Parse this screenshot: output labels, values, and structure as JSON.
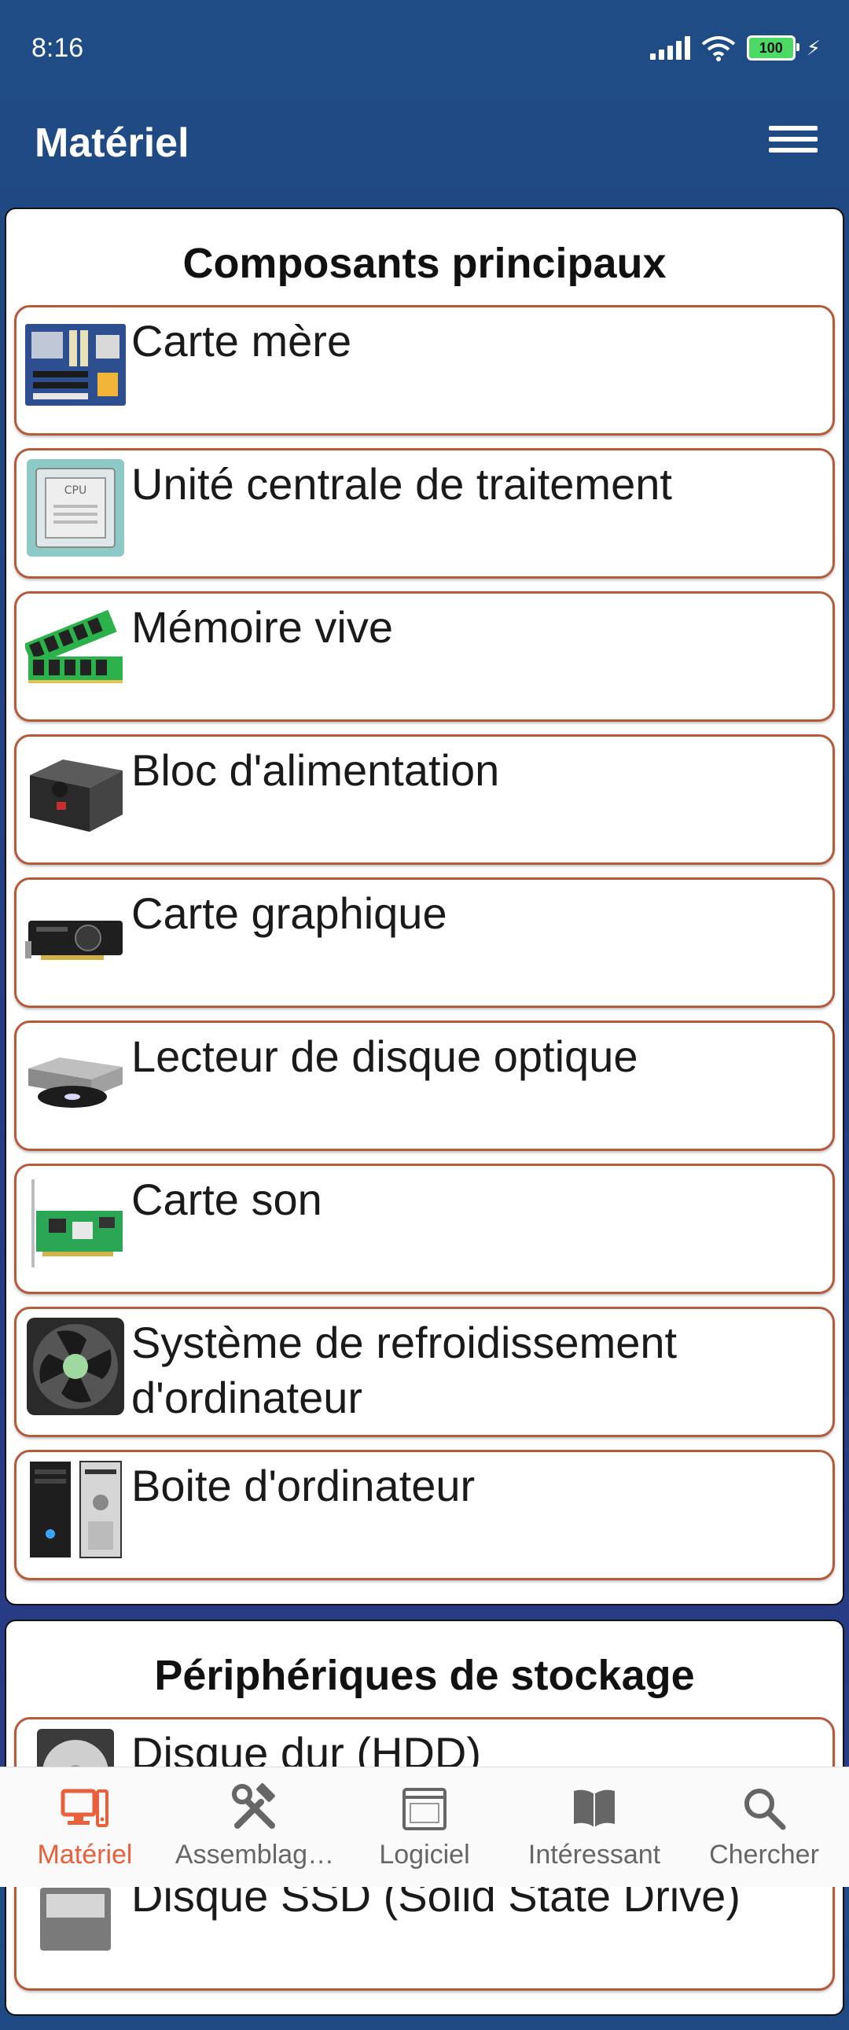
{
  "status_bar": {
    "time": "8:16",
    "battery": "100"
  },
  "app_bar": {
    "title": "Matériel"
  },
  "sections": [
    {
      "title": "Composants principaux",
      "items": [
        {
          "label": "Carte mère",
          "icon": "motherboard-icon"
        },
        {
          "label": "Unité centrale de traitement",
          "icon": "cpu-icon"
        },
        {
          "label": "Mémoire vive",
          "icon": "ram-icon"
        },
        {
          "label": "Bloc d'alimentation",
          "icon": "power-supply-icon"
        },
        {
          "label": "Carte graphique",
          "icon": "graphics-card-icon"
        },
        {
          "label": "Lecteur de disque optique",
          "icon": "optical-drive-icon"
        },
        {
          "label": "Carte son",
          "icon": "sound-card-icon"
        },
        {
          "label": "Système de refroidissement d'ordinateur",
          "icon": "cooling-fan-icon"
        },
        {
          "label": "Boite d'ordinateur",
          "icon": "computer-case-icon"
        }
      ]
    },
    {
      "title": "Périphériques de stockage",
      "items": [
        {
          "label": "Disque dur (HDD)",
          "icon": "hard-disk-icon"
        },
        {
          "label": "Disque SSD (Solid State Drive)",
          "icon": "ssd-icon"
        }
      ]
    }
  ],
  "bottom_nav": [
    {
      "label": "Matériel",
      "icon": "computer-icon",
      "active": true
    },
    {
      "label": "Assemblag…",
      "icon": "tools-icon",
      "active": false
    },
    {
      "label": "Logiciel",
      "icon": "software-window-icon",
      "active": false
    },
    {
      "label": "Intéressant",
      "icon": "book-icon",
      "active": false
    },
    {
      "label": "Chercher",
      "icon": "search-icon",
      "active": false
    }
  ],
  "colors": {
    "app_bar": "#1f4c84",
    "item_border": "#b75a3a",
    "active_nav": "#e8603c"
  }
}
